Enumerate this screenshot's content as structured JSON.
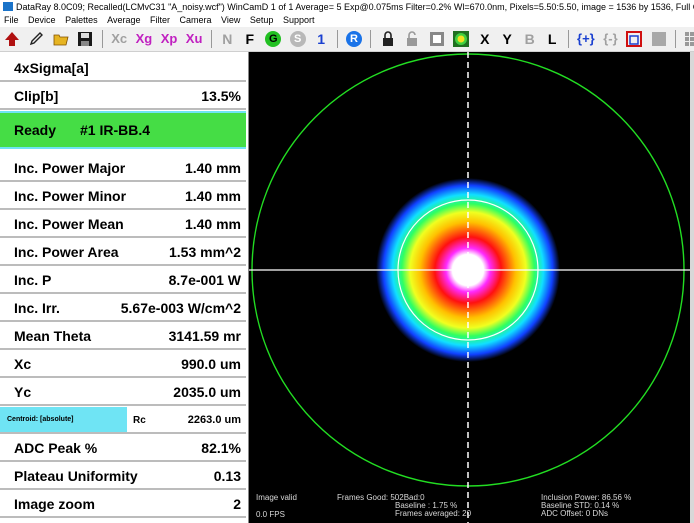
{
  "window": {
    "title": "DataRay 8.0C09; Recalled(LCMvC31 \"A_noisy.wcf\")  WinCamD 1 of 1  Average= 5  Exp@0.075ms Filter=0.2%   Wl=670.0nm, Pixels=5.50:5.50, image = 1536 by 1536, Full  Camera #1"
  },
  "menu": {
    "items": [
      "File",
      "Device",
      "Palettes",
      "Average",
      "Filter",
      "Camera",
      "View",
      "Setup",
      "Support"
    ]
  },
  "toolbar": {
    "xc": "Xc",
    "xg": "Xg",
    "xp": "Xp",
    "xu": "Xu",
    "n": "N",
    "f": "F",
    "g": "G",
    "s": "S",
    "one": "1",
    "r": "R",
    "x": "X",
    "y": "Y",
    "b": "B",
    "l": "L",
    "bracket1": "{+}",
    "bracket2": "{-}",
    "r_short": "r."
  },
  "panel": {
    "rows": [
      {
        "label": "4xSigma[a]",
        "value": ""
      },
      {
        "label": "Clip[b]",
        "value": "13.5%"
      },
      {
        "label": "Ready",
        "value": "#1 IR-BB.4"
      },
      {
        "label": "Inc. Power Major",
        "value": "1.40 mm"
      },
      {
        "label": "Inc. Power Minor",
        "value": "1.40 mm"
      },
      {
        "label": "Inc. Power Mean",
        "value": "1.40 mm"
      },
      {
        "label": "Inc. Power Area",
        "value": "1.53 mm^2"
      },
      {
        "label": "Inc. P",
        "value": "8.7e-001 W"
      },
      {
        "label": "Inc. Irr.",
        "value": "5.67e-003 W/cm^2"
      },
      {
        "label": "Mean Theta",
        "value": "3141.59 mr"
      },
      {
        "label": "Xc",
        "value": "990.0 um"
      },
      {
        "label": "Yc",
        "value": "2035.0 um"
      },
      {
        "label": "ADC Peak %",
        "value": "82.1%"
      },
      {
        "label": "Plateau Uniformity",
        "value": "0.13"
      },
      {
        "label": "Image zoom",
        "value": "2"
      }
    ],
    "centroid": {
      "mode": "Centroid: [absolute]",
      "label": "Rc",
      "value": "2263.0 um"
    }
  },
  "image": {
    "status": "Image valid",
    "fps": "0.0 FPS",
    "frames_good": "Frames Good: 502Bad:0",
    "baseline": "Baseline : 1.75 %",
    "frames_averaged": "Frames averaged: 20",
    "inclusion_power": "Inclusion Power: 86.56 %",
    "baseline_std": "Baseline STD:  0.14 %",
    "adc_offset": "ADC Offset:  0 DNs"
  },
  "colors": {
    "ready_green": "#45dd45",
    "cyan_accent": "#6fe4f4",
    "aperture_circle": "#22dd22",
    "crosshair": "#ffffff"
  }
}
